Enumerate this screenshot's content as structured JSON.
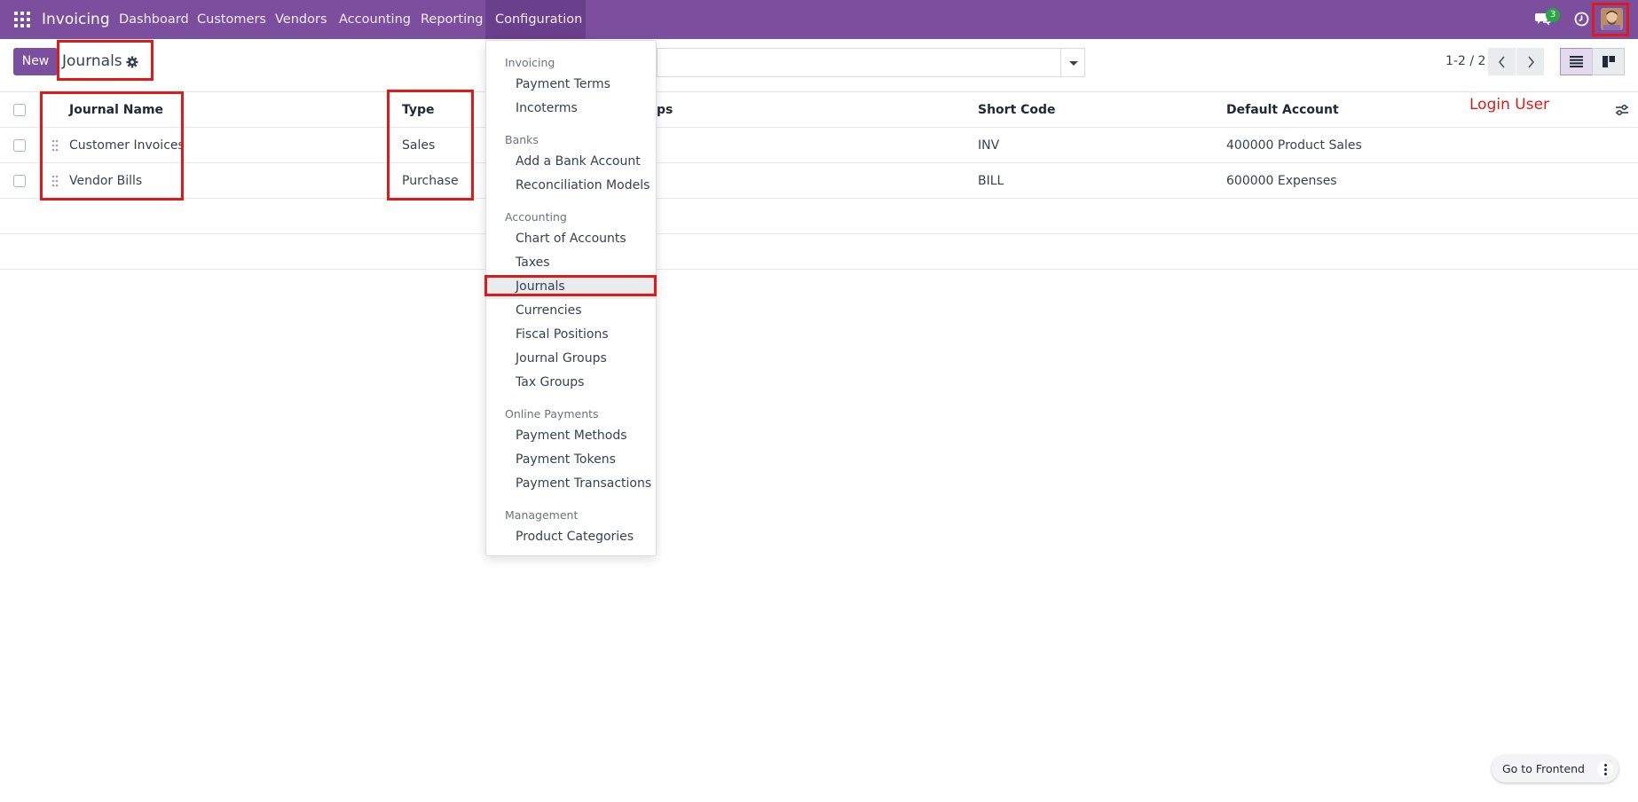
{
  "navbar": {
    "app_name": "Invoicing",
    "menu": [
      "Dashboard",
      "Customers",
      "Vendors",
      "Accounting",
      "Reporting",
      "Configuration"
    ],
    "active_menu": "Configuration",
    "chat_badge": "3",
    "bg_color": "#7b4e9e"
  },
  "control_panel": {
    "new_label": "New",
    "title": "Journals",
    "pager": "1-2 / 2"
  },
  "table": {
    "headers": {
      "name": "Journal Name",
      "type": "Type",
      "group": "ps",
      "code": "Short Code",
      "account": "Default Account"
    },
    "rows": [
      {
        "name": "Customer Invoices",
        "type": "Sales",
        "code": "INV",
        "account": "400000 Product Sales"
      },
      {
        "name": "Vendor Bills",
        "type": "Purchase",
        "code": "BILL",
        "account": "600000 Expenses"
      }
    ]
  },
  "dropdown": {
    "sections": [
      {
        "header": "Invoicing",
        "items": [
          "Payment Terms",
          "Incoterms"
        ]
      },
      {
        "header": "Banks",
        "items": [
          "Add a Bank Account",
          "Reconciliation Models"
        ]
      },
      {
        "header": "Accounting",
        "items": [
          "Chart of Accounts",
          "Taxes",
          "Journals",
          "Currencies",
          "Fiscal Positions",
          "Journal Groups",
          "Tax Groups"
        ]
      },
      {
        "header": "Online Payments",
        "items": [
          "Payment Methods",
          "Payment Tokens",
          "Payment Transactions"
        ]
      },
      {
        "header": "Management",
        "items": [
          "Product Categories"
        ]
      }
    ],
    "highlighted_item": "Journals"
  },
  "annotation": {
    "label": "Login User",
    "color": "#e01919"
  },
  "footer": {
    "frontend_label": "Go to Frontend"
  }
}
